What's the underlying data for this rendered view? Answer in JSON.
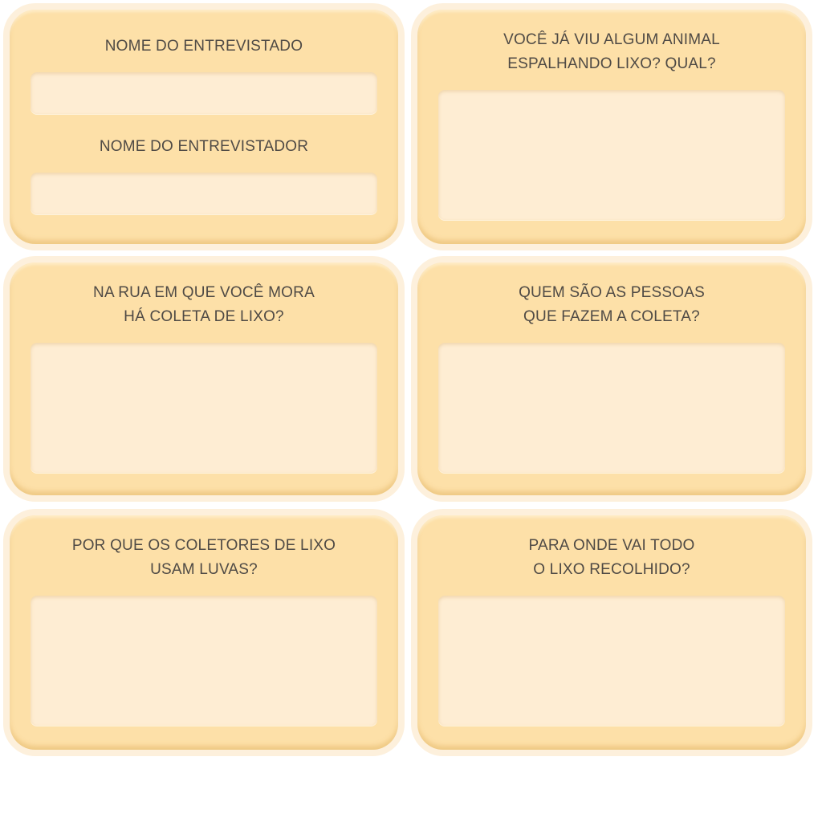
{
  "cards": {
    "names": {
      "interviewee_label": "NOME DO ENTREVISTADO",
      "interviewer_label": "NOME DO ENTREVISTADOR"
    },
    "animal": {
      "line1": "VOCÊ JÁ VIU ALGUM ANIMAL",
      "line2": "ESPALHANDO LIXO? QUAL?"
    },
    "street": {
      "line1": "NA RUA EM QUE VOCÊ MORA",
      "line2": "HÁ COLETA DE LIXO?"
    },
    "people": {
      "line1": "QUEM SÃO AS PESSOAS",
      "line2": "QUE FAZEM A COLETA?"
    },
    "gloves": {
      "line1": "POR QUE OS COLETORES DE LIXO",
      "line2": "USAM LUVAS?"
    },
    "destination": {
      "line1": "PARA ONDE VAI TODO",
      "line2": "O LIXO RECOLHIDO?"
    }
  },
  "colors": {
    "card": "#fde0a8",
    "card_border": "#fdf0dc",
    "field": "#feedd3",
    "text": "#4f4a45"
  }
}
